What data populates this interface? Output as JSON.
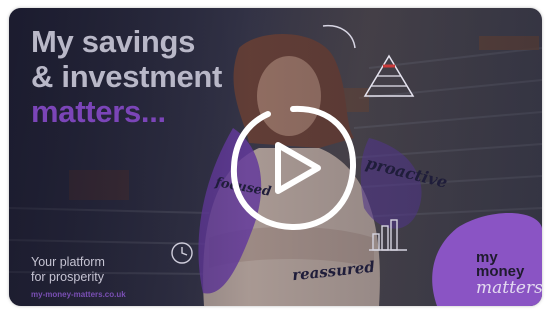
{
  "video": {
    "headline": [
      "My savings",
      "& investment",
      "matters..."
    ],
    "tagline": [
      "Your platform",
      "for prosperity"
    ],
    "url": "my-money-matters.co.uk",
    "brand": [
      "my",
      "money",
      "matters"
    ],
    "scribbles": {
      "proactive": "proactive",
      "focused": "focused",
      "reassured": "reassured"
    }
  },
  "icons": [
    "play-icon",
    "pyramid-icon",
    "bar-chart-icon",
    "clock-icon"
  ],
  "colors": {
    "headline_light": "#b9b8c8",
    "headline_accent": "#7b45b8",
    "brand_purple": "#8a54c4",
    "play_outline": "#ffffff"
  }
}
